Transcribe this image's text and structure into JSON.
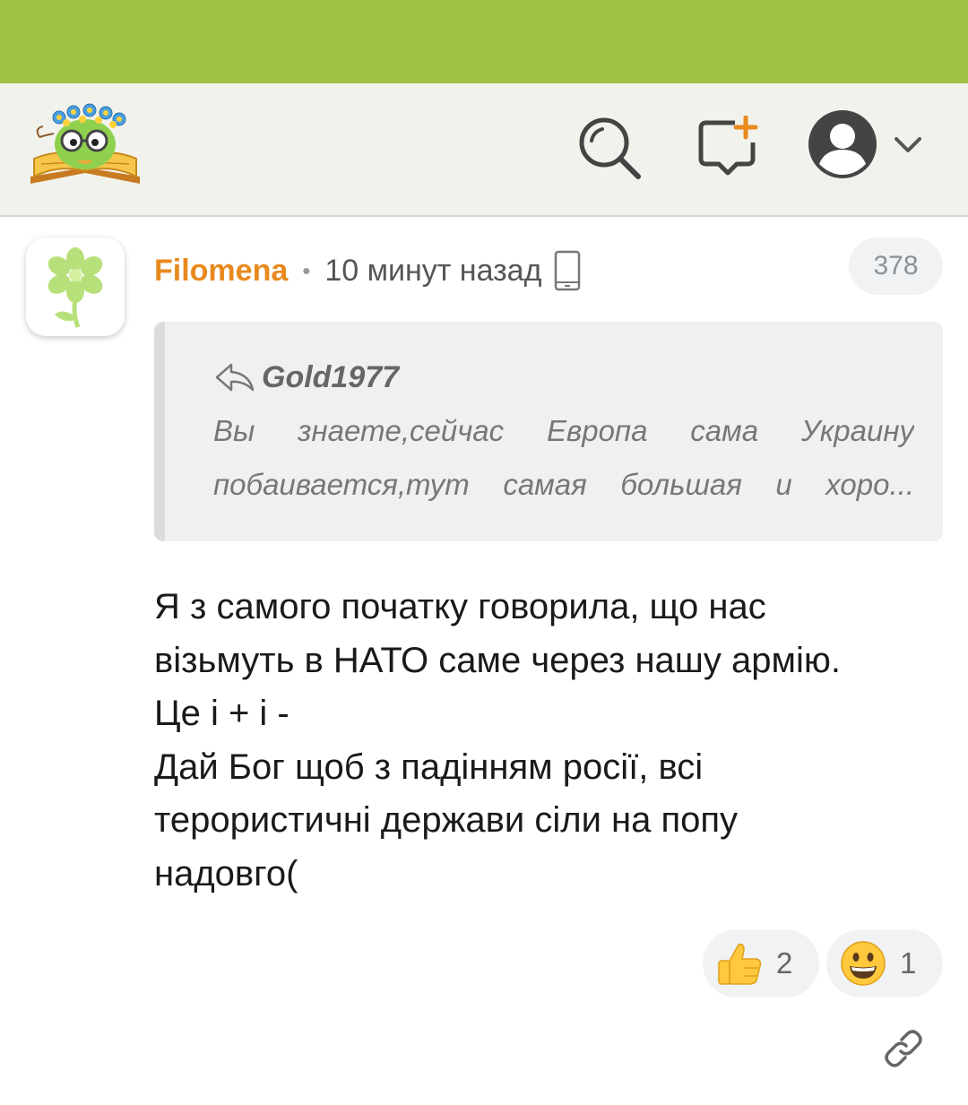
{
  "header": {
    "logo_icon": "site-logo-icon",
    "icons": [
      "search-icon",
      "new-post-icon",
      "user-avatar-icon",
      "chevron-down-icon"
    ]
  },
  "comment": {
    "author": "Filomena",
    "separator": "•",
    "time": "10 минут назад",
    "device_icon": "mobile-phone-icon",
    "count": "378",
    "quote": {
      "author": "Gold1977",
      "line1": "Вы знаете,сейчас Европа сама Украину",
      "line2": "побаивается,тут самая большая и хоро..."
    },
    "body": {
      "line1": "Я з самого початку говорила, що нас",
      "line2": "візьмуть в НАТО саме через нашу армію.",
      "line3": "Це і + і -",
      "line4": "Дай Бог щоб з падінням росії, всі",
      "line5": "терористичні держави сіли на попу",
      "line6": "надовго("
    },
    "reactions": [
      {
        "icon": "thumbs-up-emoji",
        "count": "2"
      },
      {
        "icon": "grinning-face-emoji",
        "count": "1"
      }
    ],
    "link_icon": "link-icon"
  },
  "colors": {
    "statusbar": "#9dc244",
    "header_bg": "#f2f2ec",
    "username": "#e8891e"
  }
}
